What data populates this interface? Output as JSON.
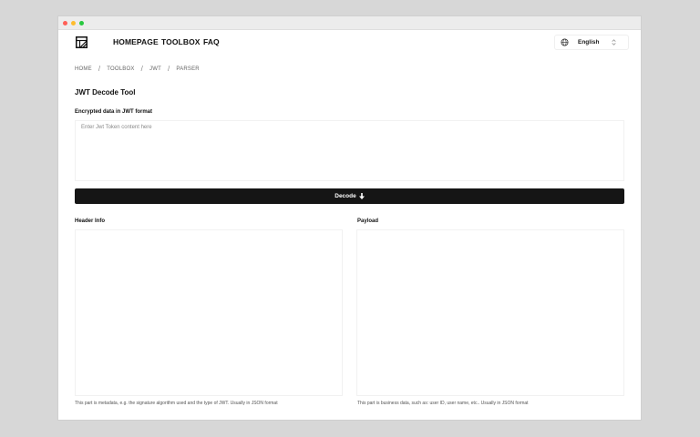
{
  "nav": {
    "links": [
      "HOMEPAGE",
      "TOOLBOX",
      "FAQ"
    ],
    "language": "English"
  },
  "breadcrumb": [
    "HOME",
    "TOOLBOX",
    "JWT",
    "PARSER"
  ],
  "page": {
    "title": "JWT Decode Tool",
    "input_label": "Encrypted data in JWT format",
    "input_placeholder": "Enter Jwt Token content here",
    "decode_label": "Decode"
  },
  "header_panel": {
    "label": "Header Info",
    "hint": "This part is metadata, e.g. the signature algorithm used and the type of JWT. Usually in JSON format"
  },
  "payload_panel": {
    "label": "Payload",
    "hint": "This part is business data, such as: user ID, user name, etc.. Usually in JSON format"
  },
  "colors": {
    "button_bg": "#151515",
    "page_bg": "#d7d7d7"
  }
}
